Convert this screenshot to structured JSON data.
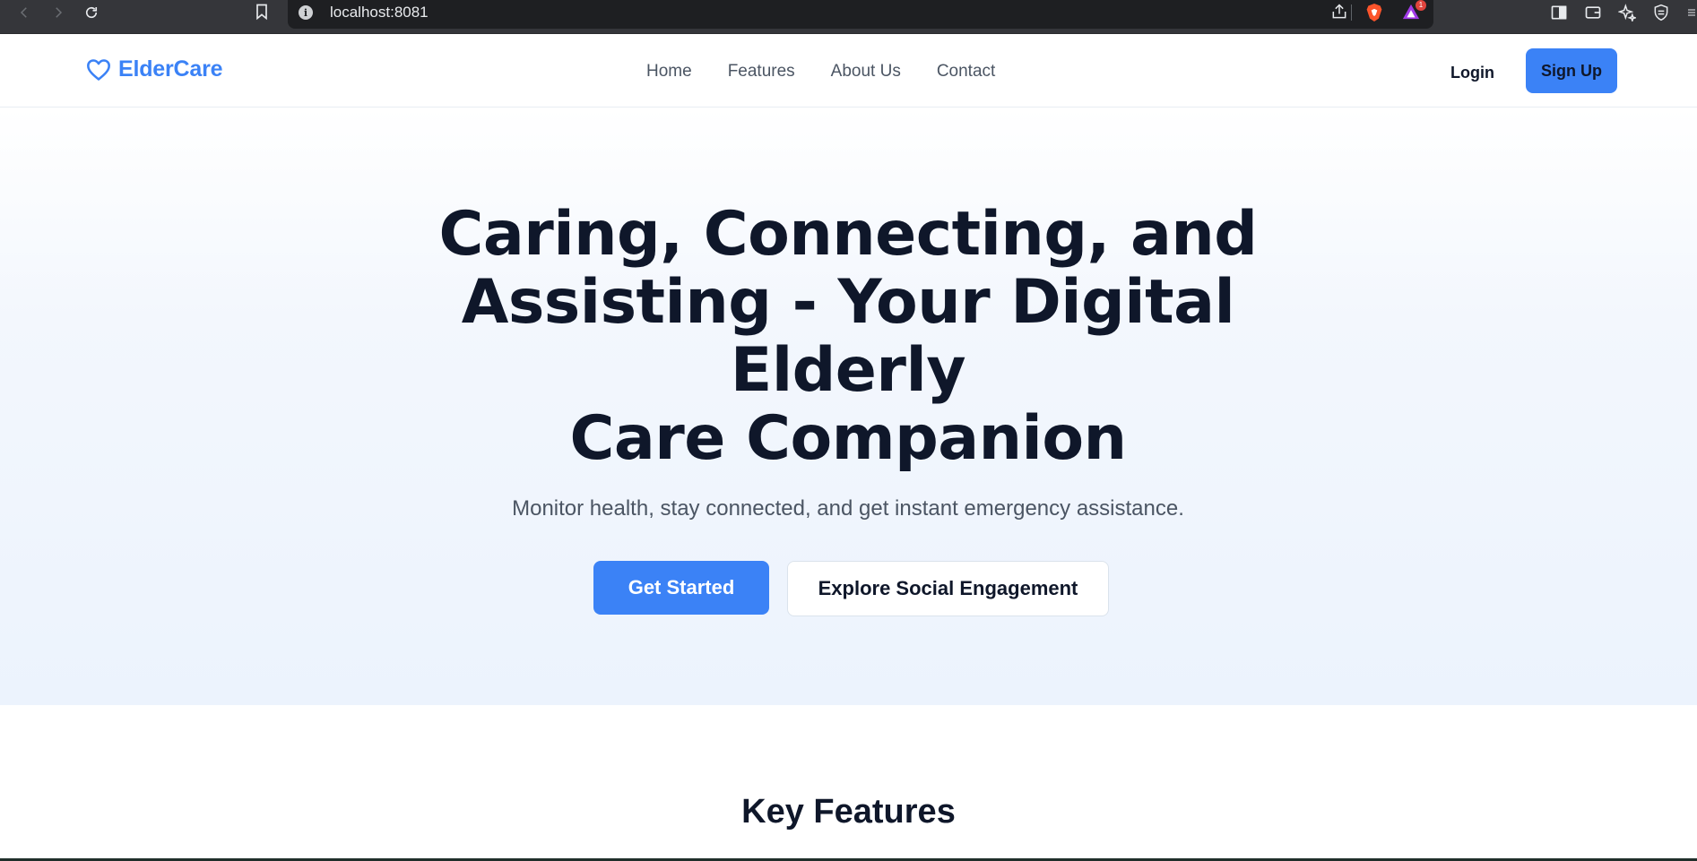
{
  "browser": {
    "url": "localhost:8081",
    "rewards_badge": "1",
    "icons": {
      "back": "chevron-left-icon",
      "forward": "chevron-right-icon",
      "reload": "reload-icon",
      "bookmark": "bookmark-icon",
      "site_info": "info-icon",
      "share": "share-icon",
      "brave": "brave-shield-icon",
      "rewards": "rewards-triangle-icon",
      "sidebar": "sidebar-icon",
      "wallet": "wallet-icon",
      "leo": "sparkle-icon",
      "vpn": "vpn-shield-icon",
      "menu": "menu-icon"
    }
  },
  "site": {
    "brand": "ElderCare",
    "brand_icon": "heart-icon",
    "nav": [
      "Home",
      "Features",
      "About Us",
      "Contact"
    ],
    "login_label": "Login",
    "signup_label": "Sign Up"
  },
  "hero": {
    "title_lines": [
      "Caring, Connecting, and",
      "Assisting - Your Digital",
      "Elderly",
      "Care Companion"
    ],
    "subtitle": "Monitor health, stay connected, and get instant emergency assistance.",
    "primary_cta": "Get Started",
    "secondary_cta": "Explore Social Engagement"
  },
  "features": {
    "title": "Key Features"
  },
  "colors": {
    "accent": "#3b82f6",
    "heading": "#0f172a",
    "muted_text": "#4b5563",
    "hero_bg": "#ecf3fd"
  }
}
